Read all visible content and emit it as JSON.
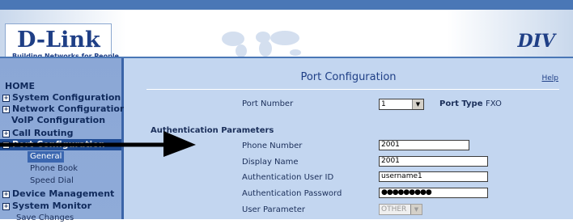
{
  "header": {
    "logo_main": "D-Link",
    "logo_sub": "Building Networks for People",
    "brand_right": "DIV"
  },
  "menu": {
    "items": [
      {
        "label": "HOME",
        "expandable": false
      },
      {
        "label": "System Configuration",
        "expandable": true
      },
      {
        "label": "Network Configuration",
        "expandable": true
      },
      {
        "label": "VoIP Configuration",
        "expandable": false
      },
      {
        "label": "Call Routing",
        "expandable": true
      },
      {
        "label": "Port Configuration",
        "expandable": true,
        "state": "expanded"
      },
      {
        "label": "General",
        "sub": true,
        "state": "selected"
      },
      {
        "label": "Phone Book",
        "sub": true
      },
      {
        "label": "Speed Dial",
        "sub": true
      },
      {
        "label": "Device Management",
        "expandable": true
      },
      {
        "label": "System Monitor",
        "expandable": true
      },
      {
        "label": "Save Changes",
        "sub": true
      }
    ]
  },
  "content": {
    "title": "Port Configuration",
    "help_link": "Help",
    "port_number_label": "Port Number",
    "port_number_value": "1",
    "port_type_label": "Port Type",
    "port_type_value": "FXO",
    "section_title": "Authentication Parameters",
    "phone_number_label": "Phone Number",
    "phone_number_value": "2001",
    "display_name_label": "Display Name",
    "display_name_value": "2001",
    "auth_user_id_label": "Authentication User ID",
    "auth_user_id_value": "username1",
    "auth_password_label": "Authentication Password",
    "auth_password_value": "●●●●●●●●●",
    "user_parameter_label": "User Parameter",
    "user_parameter_value": "OTHER"
  },
  "colors": {
    "topbar": "#4a77b6",
    "sidebar": "#8ba7d6",
    "content_bg": "#c3d6f0",
    "brand": "#1f3f86"
  }
}
